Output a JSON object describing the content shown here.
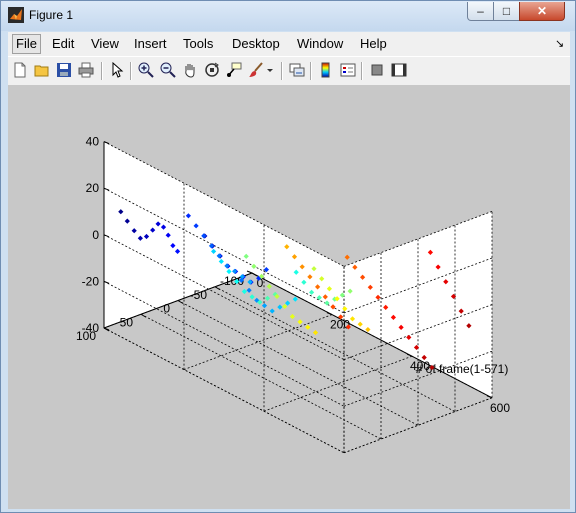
{
  "window": {
    "title": "Figure 1",
    "minimize": "–",
    "maximize": "□",
    "close": "✕"
  },
  "menu": [
    {
      "name": "menu-file",
      "label": "File"
    },
    {
      "name": "menu-edit",
      "label": "Edit"
    },
    {
      "name": "menu-view",
      "label": "View"
    },
    {
      "name": "menu-insert",
      "label": "Insert"
    },
    {
      "name": "menu-tools",
      "label": "Tools"
    },
    {
      "name": "menu-desktop",
      "label": "Desktop"
    },
    {
      "name": "menu-window",
      "label": "Window"
    },
    {
      "name": "menu-help",
      "label": "Help"
    }
  ],
  "toolbar_icons": [
    "new-figure-icon",
    "open-file-icon",
    "save-icon",
    "print-icon",
    "edit-plot-arrow-icon",
    "zoom-in-icon",
    "zoom-out-icon",
    "pan-hand-icon",
    "rotate-3d-icon",
    "data-cursor-icon",
    "brush-icon",
    "brush-dropdown-icon",
    "link-plot-icon",
    "colorbar-icon",
    "legend-icon",
    "hide-plot-tools-icon",
    "show-plot-tools-icon"
  ],
  "chart_data": {
    "type": "scatter",
    "title": "",
    "xlabel": "# of frame(1-571)",
    "ylabel": "",
    "zlabel": "",
    "xlim": [
      0,
      600
    ],
    "ylim": [
      -100,
      100
    ],
    "zlim": [
      -40,
      40
    ],
    "x_ticks": [
      "0",
      "200",
      "400",
      "600"
    ],
    "y_ticks": [
      "-100",
      "-50",
      "0",
      "50",
      "100"
    ],
    "z_ticks": [
      "-40",
      "-20",
      "0",
      "20",
      "40"
    ],
    "grid": true,
    "colormap": "jet",
    "color_by": "x",
    "series": [
      {
        "x": [
          5,
          12,
          20,
          28,
          36,
          44,
          52,
          60,
          68,
          76,
          84
        ],
        "y": [
          80,
          75,
          70,
          66,
          62,
          58,
          55,
          52,
          50,
          48,
          46
        ],
        "z": [
          8,
          4,
          0,
          -3,
          -2,
          1,
          4,
          3,
          0,
          -4,
          -6
        ]
      },
      {
        "x": [
          30,
          40,
          50,
          60,
          70,
          80,
          90,
          100,
          110
        ],
        "y": [
          -20,
          -25,
          -30,
          -35,
          -40,
          -45,
          -50,
          -55,
          -60
        ],
        "z": [
          -12,
          -16,
          -20,
          -24,
          -26,
          -28,
          -30,
          -28,
          -24
        ]
      },
      {
        "x": [
          100,
          110,
          120,
          130,
          140,
          150,
          160,
          170,
          180
        ],
        "y": [
          40,
          35,
          30,
          25,
          20,
          15,
          10,
          5,
          0
        ],
        "z": [
          10,
          6,
          2,
          -2,
          -6,
          -10,
          -12,
          -14,
          -16
        ]
      },
      {
        "x": [
          140,
          150,
          160,
          170,
          180,
          190,
          200,
          210
        ],
        "y": [
          -10,
          -15,
          -20,
          -25,
          -30,
          -35,
          -40,
          -45
        ],
        "z": [
          -20,
          -24,
          -28,
          -30,
          -32,
          -30,
          -28,
          -26
        ]
      },
      {
        "x": [
          200,
          210,
          220,
          230,
          240,
          250,
          260,
          270,
          280
        ],
        "y": [
          60,
          55,
          50,
          45,
          40,
          35,
          30,
          25,
          20
        ],
        "z": [
          6,
          2,
          -2,
          -6,
          -10,
          -12,
          -14,
          -12,
          -10
        ]
      },
      {
        "x": [
          240,
          250,
          260,
          270,
          280,
          290,
          300,
          310
        ],
        "y": [
          -30,
          -35,
          -40,
          -45,
          -50,
          -55,
          -60,
          -65
        ],
        "z": [
          -10,
          -14,
          -18,
          -20,
          -22,
          -20,
          -18,
          -16
        ]
      },
      {
        "x": [
          300,
          310,
          320,
          330,
          340,
          350,
          360,
          370,
          380,
          390
        ],
        "y": [
          70,
          65,
          60,
          55,
          50,
          45,
          40,
          35,
          30,
          25
        ],
        "z": [
          14,
          10,
          6,
          2,
          -2,
          -6,
          -10,
          -12,
          -14,
          -16
        ]
      },
      {
        "x": [
          340,
          350,
          360,
          370,
          380,
          390,
          400,
          410
        ],
        "y": [
          0,
          -5,
          -10,
          -15,
          -20,
          -25,
          -30,
          -35
        ],
        "z": [
          4,
          0,
          -4,
          -8,
          -12,
          -16,
          -18,
          -20
        ]
      },
      {
        "x": [
          420,
          430,
          440,
          450,
          460,
          470,
          480,
          490,
          500
        ],
        "y": [
          80,
          75,
          70,
          65,
          60,
          55,
          50,
          45,
          40
        ],
        "z": [
          30,
          26,
          22,
          18,
          14,
          10,
          6,
          2,
          -2
        ]
      },
      {
        "x": [
          460,
          470,
          480,
          490,
          500,
          510,
          520,
          530,
          540,
          550,
          560,
          570
        ],
        "y": [
          20,
          15,
          10,
          5,
          0,
          -5,
          -10,
          -15,
          -20,
          -25,
          -30,
          -35
        ],
        "z": [
          22,
          18,
          14,
          10,
          6,
          2,
          -2,
          -6,
          -10,
          -14,
          -18,
          -22
        ]
      },
      {
        "x": [
          520,
          530,
          540,
          550,
          560,
          570
        ],
        "y": [
          -60,
          -65,
          -70,
          -75,
          -80,
          -85
        ],
        "z": [
          20,
          14,
          8,
          2,
          -4,
          -10
        ]
      }
    ]
  }
}
